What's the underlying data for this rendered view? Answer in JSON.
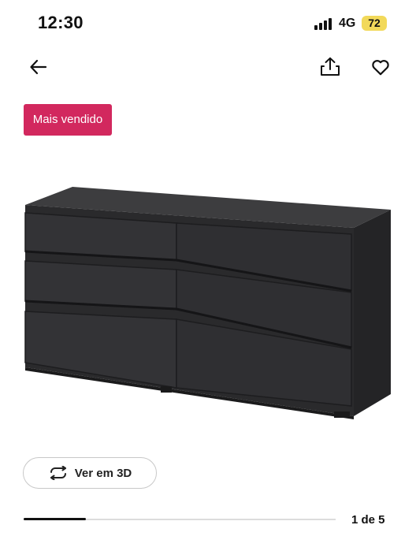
{
  "status_bar": {
    "time": "12:30",
    "network": "4G",
    "battery": "72",
    "battery_color": "#f2d95a"
  },
  "nav": {
    "back_icon": "arrow-left-icon",
    "share_icon": "share-icon",
    "favorite_icon": "heart-icon"
  },
  "badge": {
    "label": "Mais vendido",
    "color": "#d2285e"
  },
  "product": {
    "image": "black-six-drawer-dresser"
  },
  "view3d": {
    "label": "Ver em 3D",
    "icon": "rotate-3d-icon"
  },
  "carousel": {
    "counter": "1 de 5",
    "current": 1,
    "total": 5
  }
}
